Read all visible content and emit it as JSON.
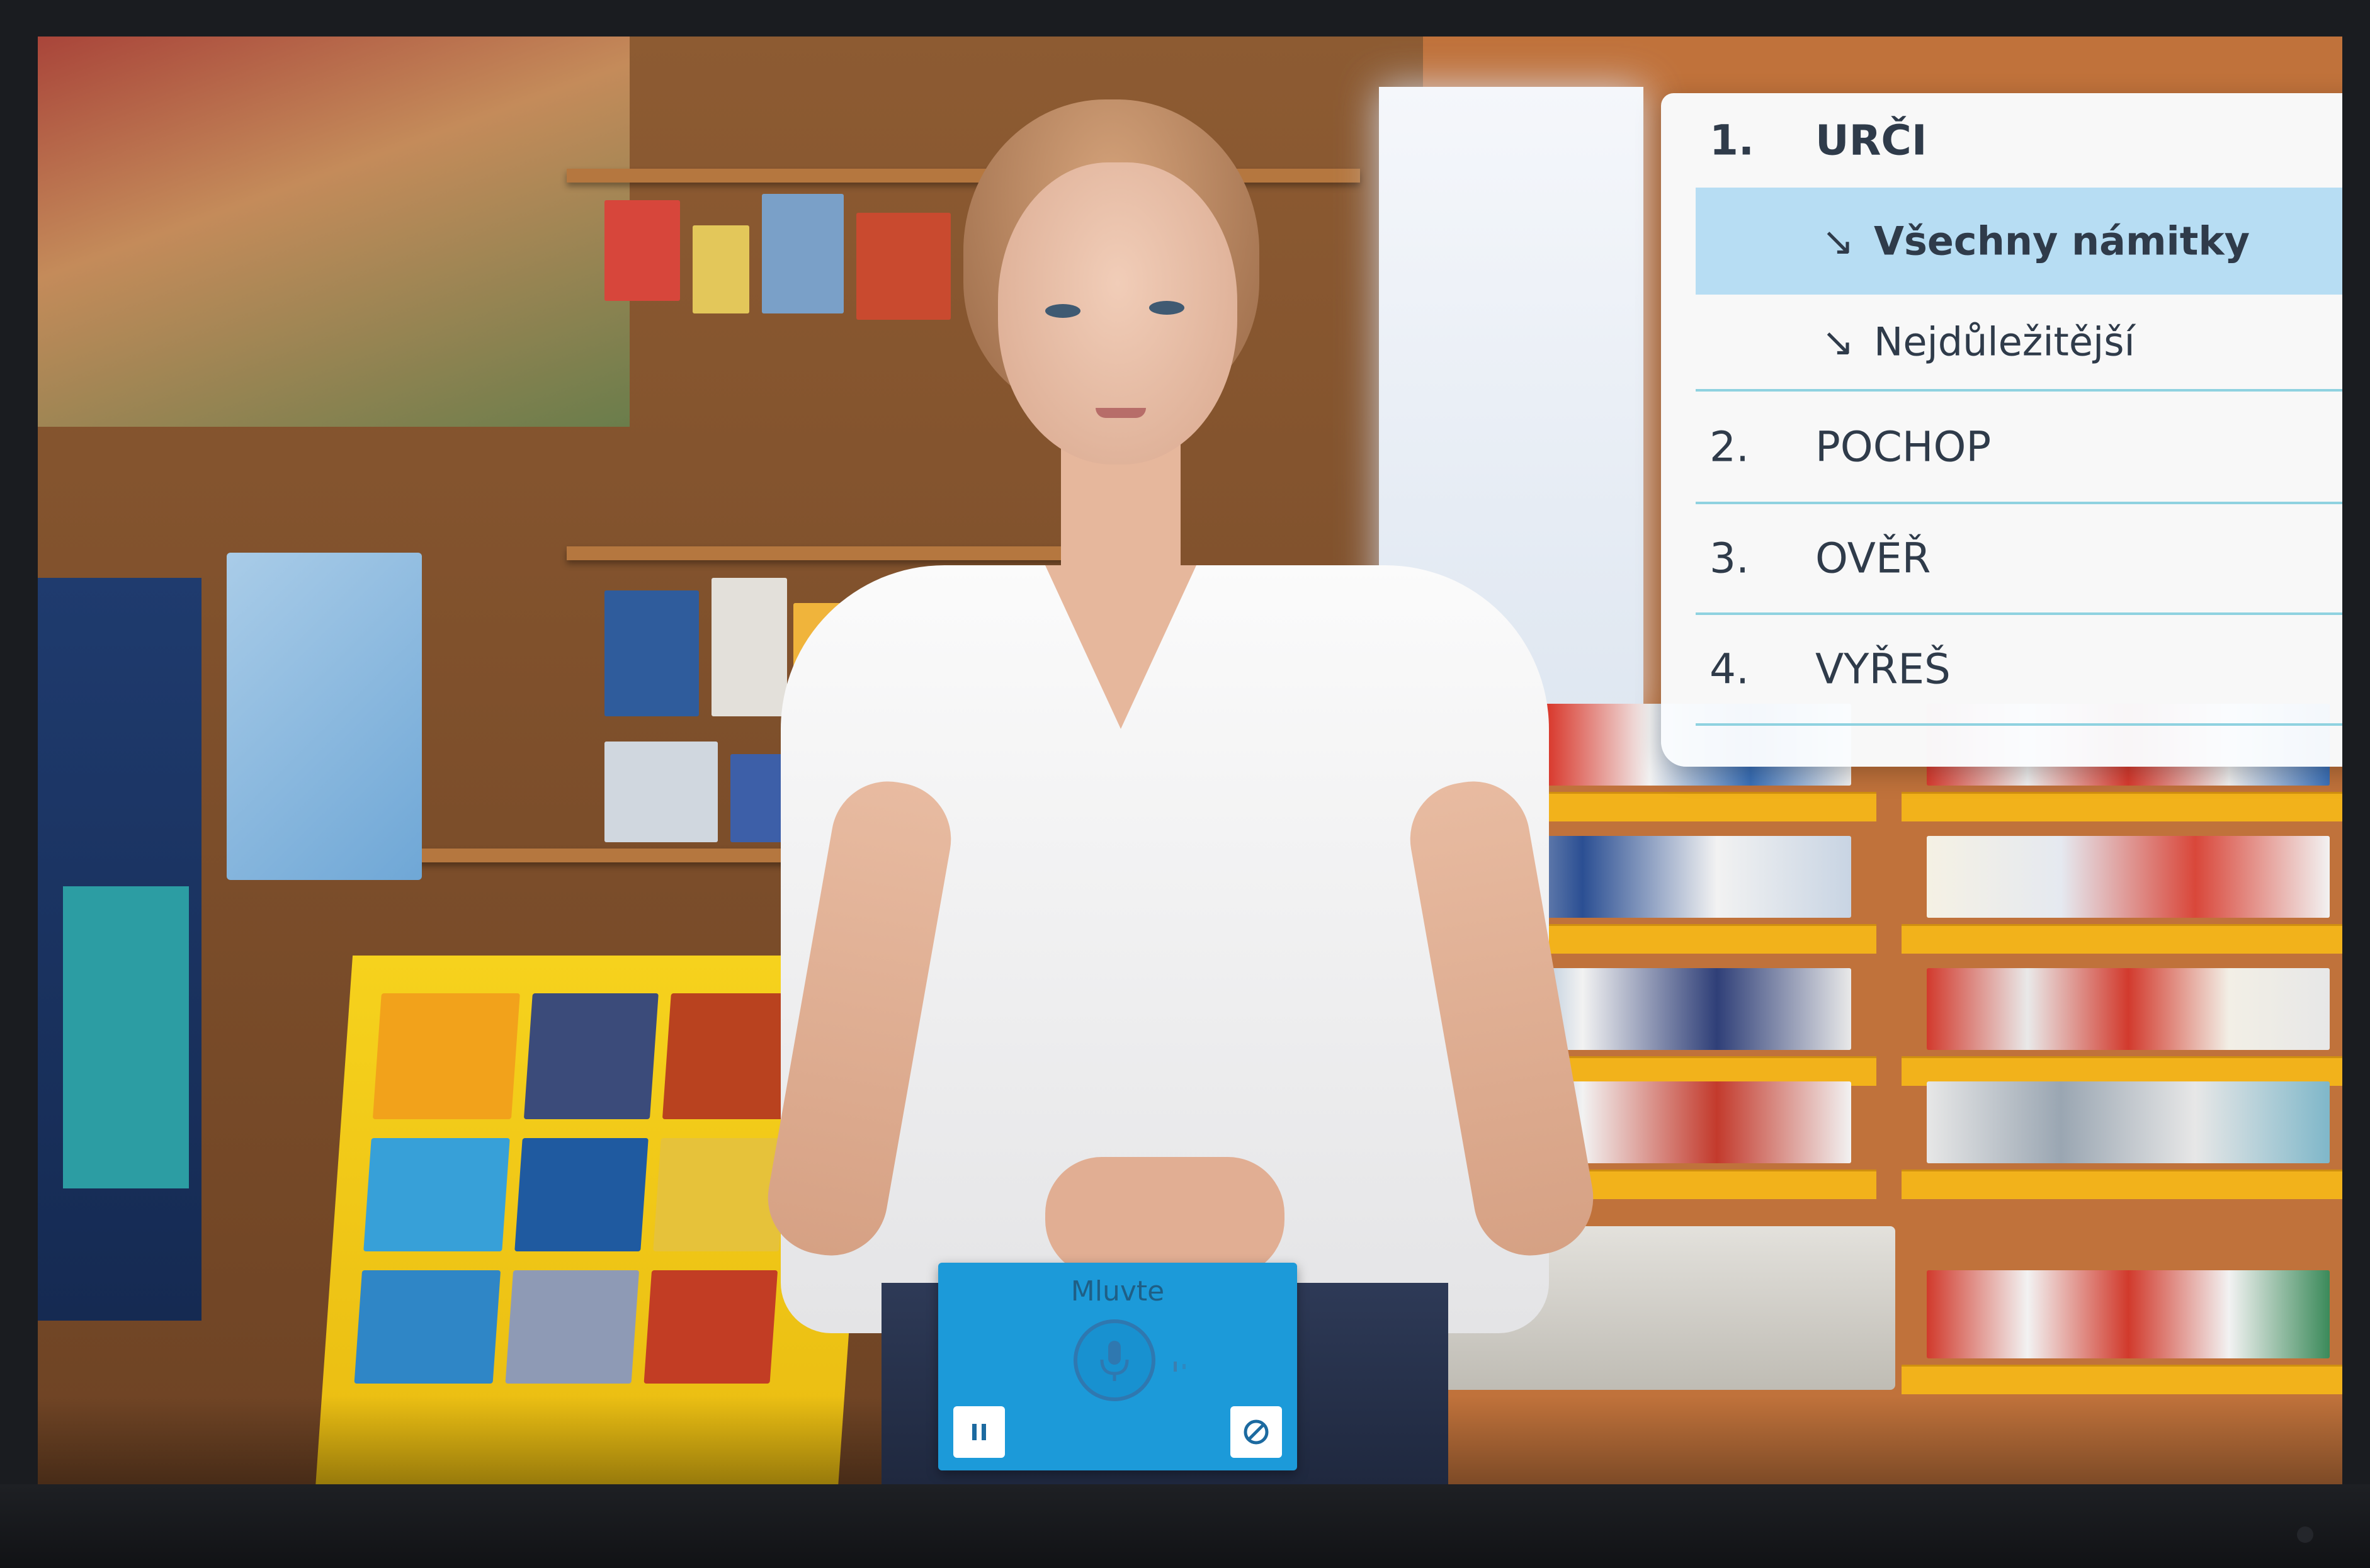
{
  "steps_panel": {
    "steps": [
      {
        "number": "1.",
        "label": "URČI"
      },
      {
        "number": "2.",
        "label": "POCHOP"
      },
      {
        "number": "3.",
        "label": "OVĚŘ"
      },
      {
        "number": "4.",
        "label": "VYŘEŠ"
      }
    ],
    "substeps": [
      {
        "arrow": "↘",
        "label": "Všechny námitky",
        "selected": true
      },
      {
        "arrow": "↘",
        "label": "Nejdůležitější",
        "selected": false
      }
    ],
    "accent_color": "#8fd2e0",
    "highlight_color": "#b7ddf3"
  },
  "voice_control": {
    "title": "Mluvte",
    "mic_icon": "microphone-icon",
    "pause_icon": "pause-icon",
    "cancel_icon": "cancel-icon",
    "background_color": "#1c9ad9"
  }
}
